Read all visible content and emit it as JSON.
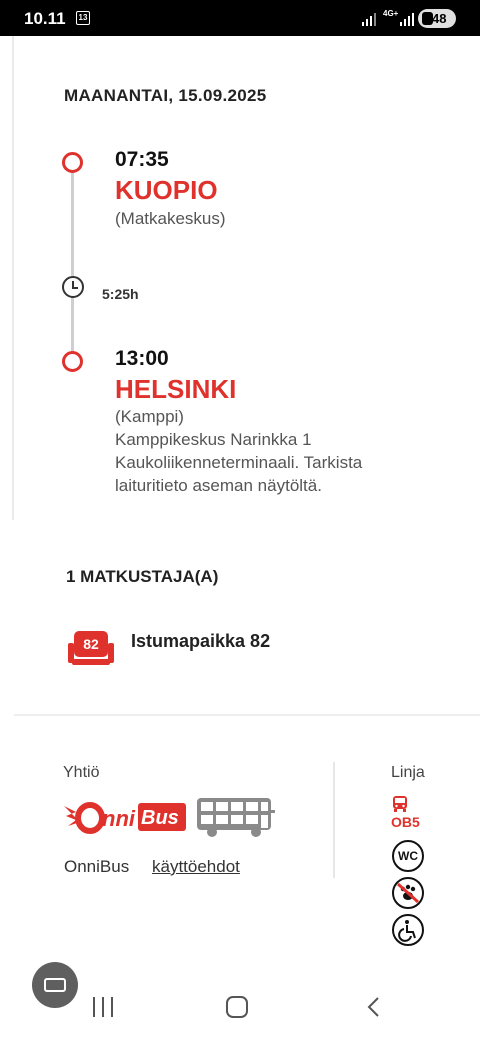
{
  "status_bar": {
    "time": "10.11",
    "calendar_day": "13",
    "network": "4G+",
    "battery": "48"
  },
  "trip": {
    "date": "MAANANTAI, 15.09.2025",
    "departure": {
      "time": "07:35",
      "city": "KUOPIO",
      "station": "(Matkakeskus)"
    },
    "duration": "5:25h",
    "arrival": {
      "time": "13:00",
      "city": "HELSINKI",
      "station": "(Kamppi)",
      "details_line1": "Kamppikeskus Narinkka 1",
      "details_line2": "Kaukoliikenneterminaali. Tarkista",
      "details_line3": "laituritieto aseman näytöltä."
    }
  },
  "passengers": {
    "title": "1 MATKUSTAJA(A)",
    "seat_number": "82",
    "seat_label": "Istumapaikka 82"
  },
  "operator": {
    "company_label": "Yhtiö",
    "logo_text": "OnniBus",
    "company_name": "OnniBus",
    "terms_link": "käyttöehdot",
    "line_label": "Linja",
    "line_code": "OB5",
    "wc_text": "WC",
    "amenity_icons": [
      "wc-icon",
      "no-pets-icon",
      "wheelchair-icon"
    ]
  },
  "colors": {
    "accent_red": "#e0322c",
    "text_dark": "#222222"
  }
}
